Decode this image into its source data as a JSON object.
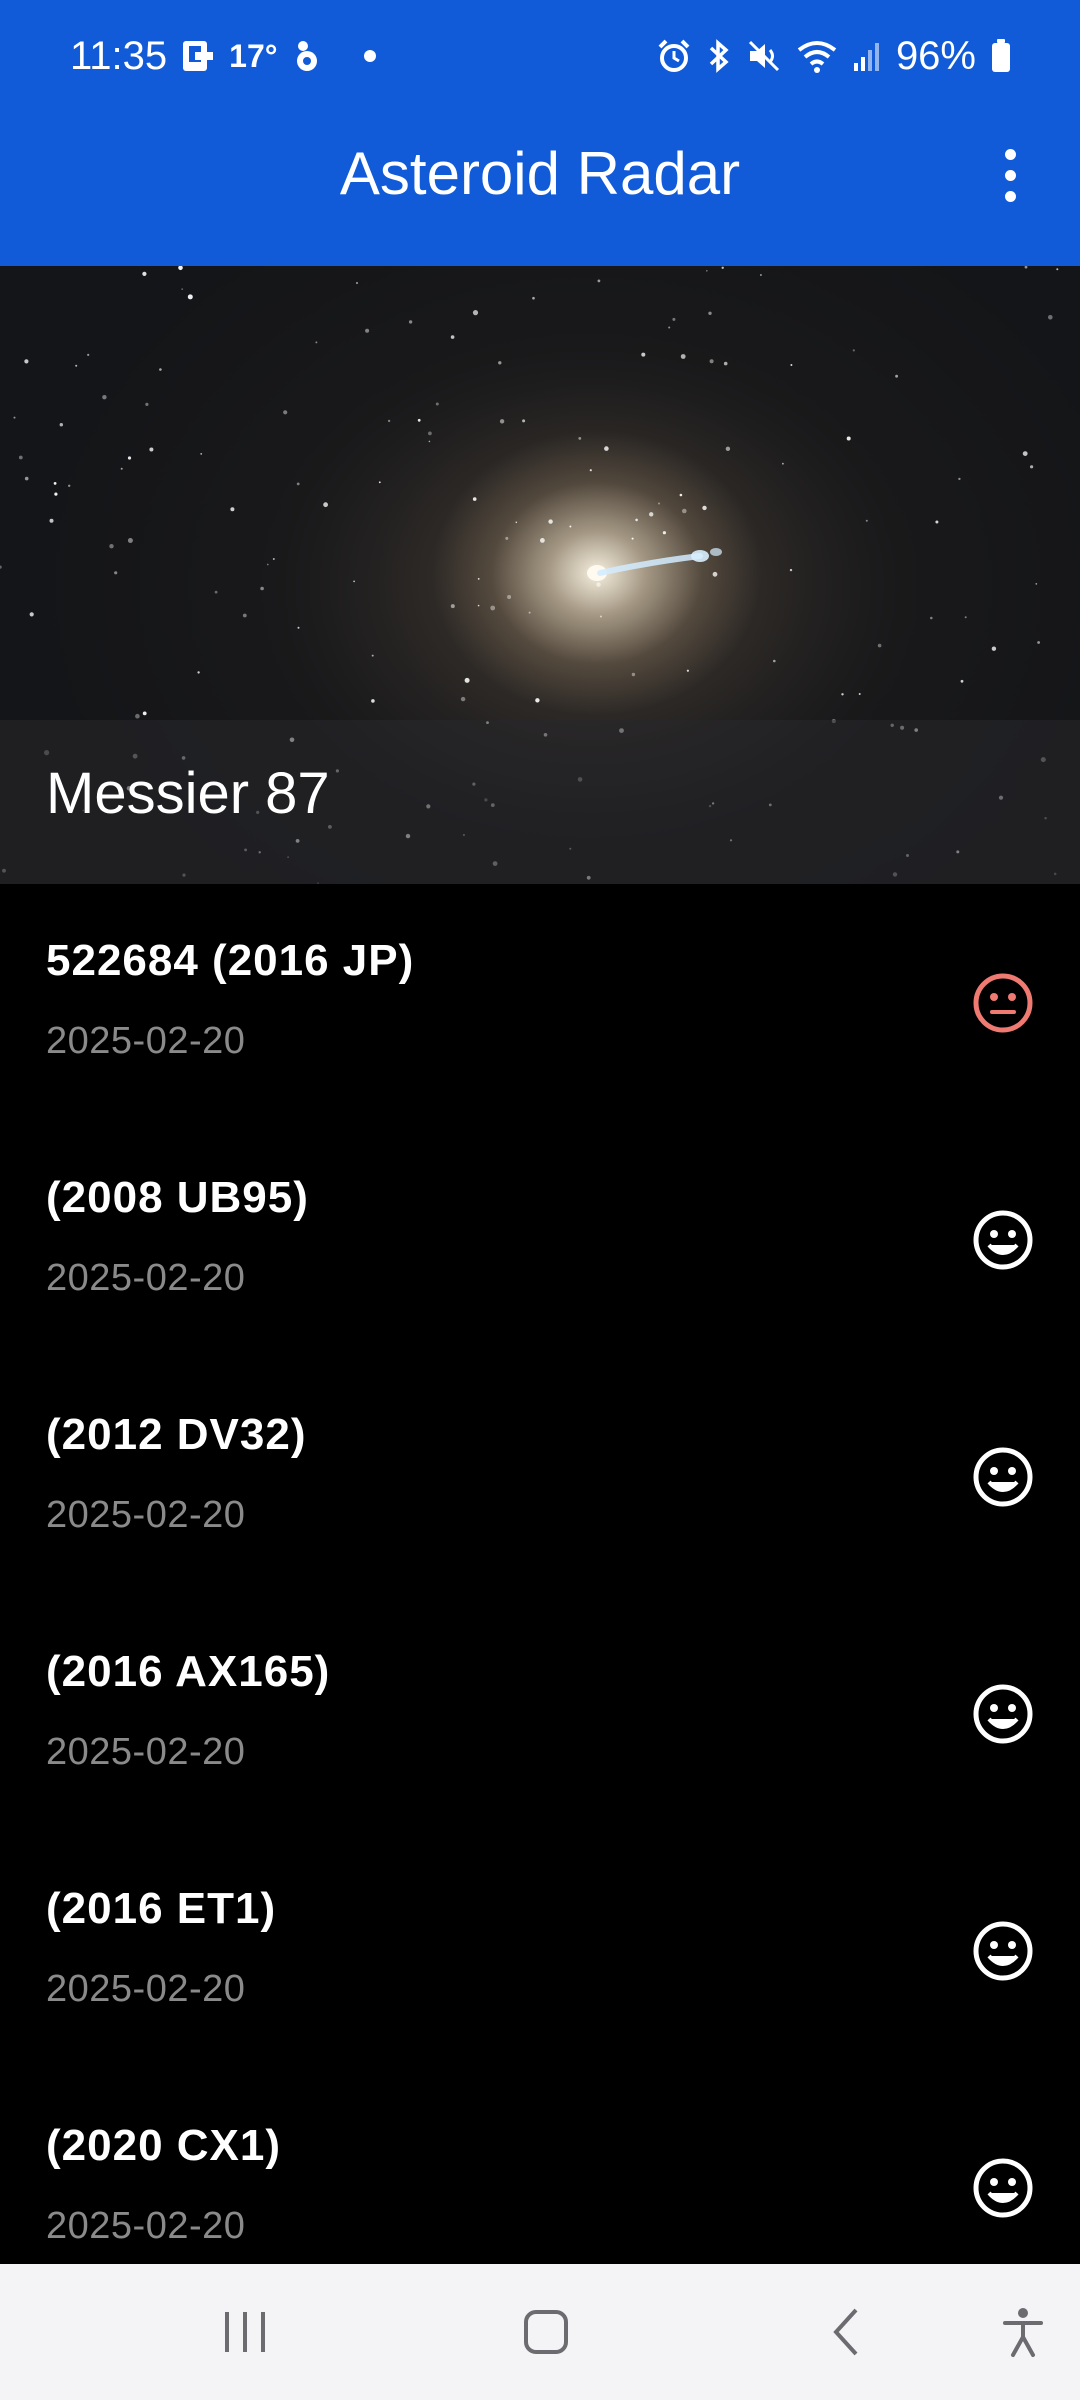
{
  "status_bar": {
    "time": "11:35",
    "temperature": "17°",
    "battery": "96%"
  },
  "app_bar": {
    "title": "Asteroid Radar",
    "menu_icon": "more-vert-icon"
  },
  "picture_of_day": {
    "title": "Messier 87"
  },
  "asteroids": [
    {
      "name": "522684 (2016 JP)",
      "date": "2025-02-20",
      "status_icon": "face-neutral-icon",
      "hazardous": true,
      "color": "#ef7a72"
    },
    {
      "name": "(2008 UB95)",
      "date": "2025-02-20",
      "status_icon": "face-happy-icon",
      "hazardous": false,
      "color": "#ffffff"
    },
    {
      "name": "(2012 DV32)",
      "date": "2025-02-20",
      "status_icon": "face-happy-icon",
      "hazardous": false,
      "color": "#ffffff"
    },
    {
      "name": "(2016 AX165)",
      "date": "2025-02-20",
      "status_icon": "face-happy-icon",
      "hazardous": false,
      "color": "#ffffff"
    },
    {
      "name": "(2016 ET1)",
      "date": "2025-02-20",
      "status_icon": "face-happy-icon",
      "hazardous": false,
      "color": "#ffffff"
    },
    {
      "name": "(2020 CX1)",
      "date": "2025-02-20",
      "status_icon": "face-happy-icon",
      "hazardous": false,
      "color": "#ffffff"
    }
  ],
  "colors": {
    "app_bar": "#115bd9",
    "background": "#000000",
    "date_text": "#8a8a8a",
    "nav_bar": "#f4f4f6"
  },
  "nav_bar": {
    "icons": [
      "recents-icon",
      "home-icon",
      "back-icon",
      "accessibility-icon"
    ]
  }
}
